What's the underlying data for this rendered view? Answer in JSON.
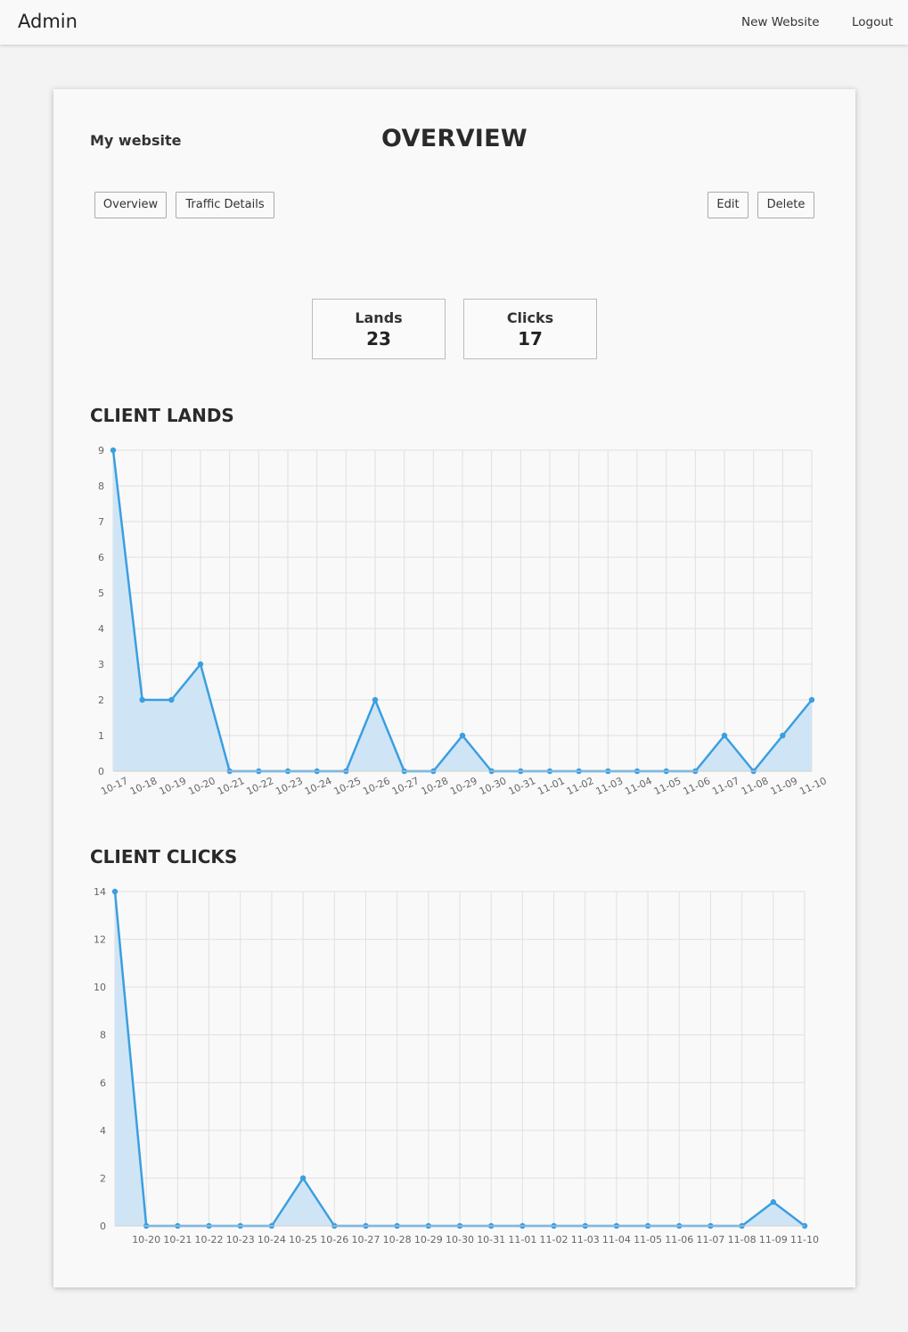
{
  "header": {
    "brand": "Admin",
    "new_website": "New Website",
    "logout": "Logout"
  },
  "page": {
    "site_name": "My website",
    "title": "OVERVIEW"
  },
  "buttons": {
    "overview": "Overview",
    "traffic": "Traffic Details",
    "edit": "Edit",
    "delete": "Delete"
  },
  "stats": {
    "lands_label": "Lands",
    "lands_value": "23",
    "clicks_label": "Clicks",
    "clicks_value": "17"
  },
  "sections": {
    "lands_title": "CLIENT LANDS",
    "clicks_title": "CLIENT CLICKS"
  },
  "colors": {
    "line": "#3a9fe0",
    "fill": "#cfe5f6"
  },
  "chart_data": [
    {
      "type": "area",
      "categories": [
        "10-17",
        "10-18",
        "10-19",
        "10-20",
        "10-21",
        "10-22",
        "10-23",
        "10-24",
        "10-25",
        "10-26",
        "10-27",
        "10-28",
        "10-29",
        "10-30",
        "10-31",
        "11-01",
        "11-02",
        "11-03",
        "11-04",
        "11-05",
        "11-06",
        "11-07",
        "11-08",
        "11-09",
        "11-10"
      ],
      "values": [
        9,
        2,
        2,
        3,
        0,
        0,
        0,
        0,
        0,
        2,
        0,
        0,
        1,
        0,
        0,
        0,
        0,
        0,
        0,
        0,
        0,
        1,
        0,
        1,
        2
      ],
      "yticks": [
        0,
        1,
        2,
        3,
        4,
        5,
        6,
        7,
        8,
        9
      ],
      "ylim": [
        0,
        9
      ],
      "grid": true,
      "rotated_labels": true
    },
    {
      "type": "area",
      "categories": [
        "10-20",
        "10-21",
        "10-22",
        "10-23",
        "10-24",
        "10-25",
        "10-26",
        "10-27",
        "10-28",
        "10-29",
        "10-30",
        "10-31",
        "11-01",
        "11-02",
        "11-03",
        "11-04",
        "11-05",
        "11-06",
        "11-07",
        "11-08",
        "11-09",
        "11-10"
      ],
      "values": [
        14,
        0,
        0,
        0,
        0,
        0,
        2,
        0,
        0,
        0,
        0,
        0,
        0,
        0,
        0,
        0,
        0,
        0,
        0,
        0,
        0,
        1,
        0
      ],
      "yticks": [
        0,
        2,
        4,
        6,
        8,
        10,
        12,
        14
      ],
      "ylim": [
        0,
        14
      ],
      "grid": true,
      "rotated_labels": false
    }
  ]
}
